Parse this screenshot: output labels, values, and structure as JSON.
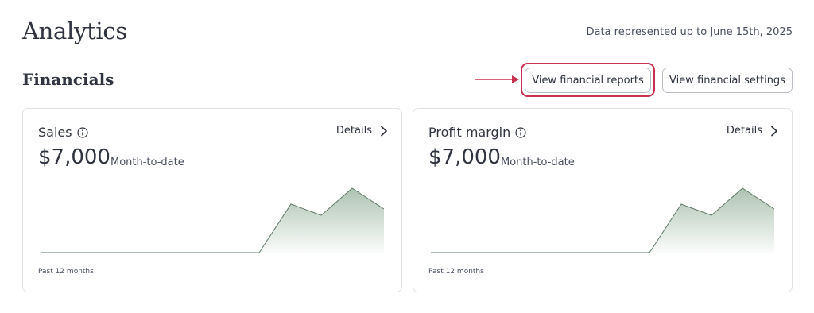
{
  "header": {
    "title": "Analytics",
    "data_note": "Data represented up to June 15th, 2025"
  },
  "section": {
    "title": "Financials",
    "buttons": {
      "reports": "View financial reports",
      "settings": "View financial settings"
    }
  },
  "cards": [
    {
      "title": "Sales",
      "details_label": "Details",
      "value": "$7,000",
      "value_caption": "Month-to-date",
      "period": "Past 12 months"
    },
    {
      "title": "Profit margin",
      "details_label": "Details",
      "value": "$7,000",
      "value_caption": "Month-to-date",
      "period": "Past 12 months"
    }
  ],
  "colors": {
    "highlight": "#c8304f",
    "chart_line": "#6e8a74",
    "chart_fill": "#9fb8a4"
  },
  "icons": [
    "info-icon",
    "chevron-right-icon",
    "arrow-right-icon"
  ]
}
